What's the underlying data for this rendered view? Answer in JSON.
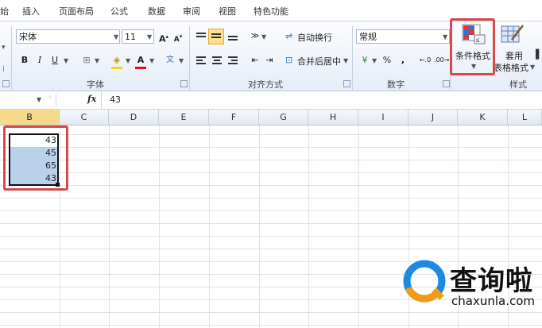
{
  "tabs": [
    "始",
    "插入",
    "页面布局",
    "公式",
    "数据",
    "审阅",
    "视图",
    "特色功能"
  ],
  "font": {
    "name": "宋体",
    "size": "11",
    "group_label": "字体"
  },
  "alignment": {
    "wrap_label": "自动换行",
    "merge_label": "合并后居中",
    "group_label": "对齐方式"
  },
  "number": {
    "format": "常规",
    "group_label": "数字"
  },
  "styles": {
    "cond_format_label": "条件格式",
    "table_format_label_1": "套用",
    "table_format_label_2": "表格格式",
    "group_label": "样式"
  },
  "formula_bar": {
    "fx_label": "fx",
    "value": "43"
  },
  "columns": [
    "B",
    "C",
    "D",
    "E",
    "F",
    "G",
    "H",
    "I",
    "J",
    "K",
    "L"
  ],
  "cells": [
    "43",
    "45",
    "65",
    "43"
  ],
  "watermark": {
    "brand": "查询啦",
    "site": "chaxunla.com"
  },
  "colors": {
    "selection": "#b9d1ea",
    "highlight_box": "#d64a4a",
    "accent": "#fde08a"
  }
}
